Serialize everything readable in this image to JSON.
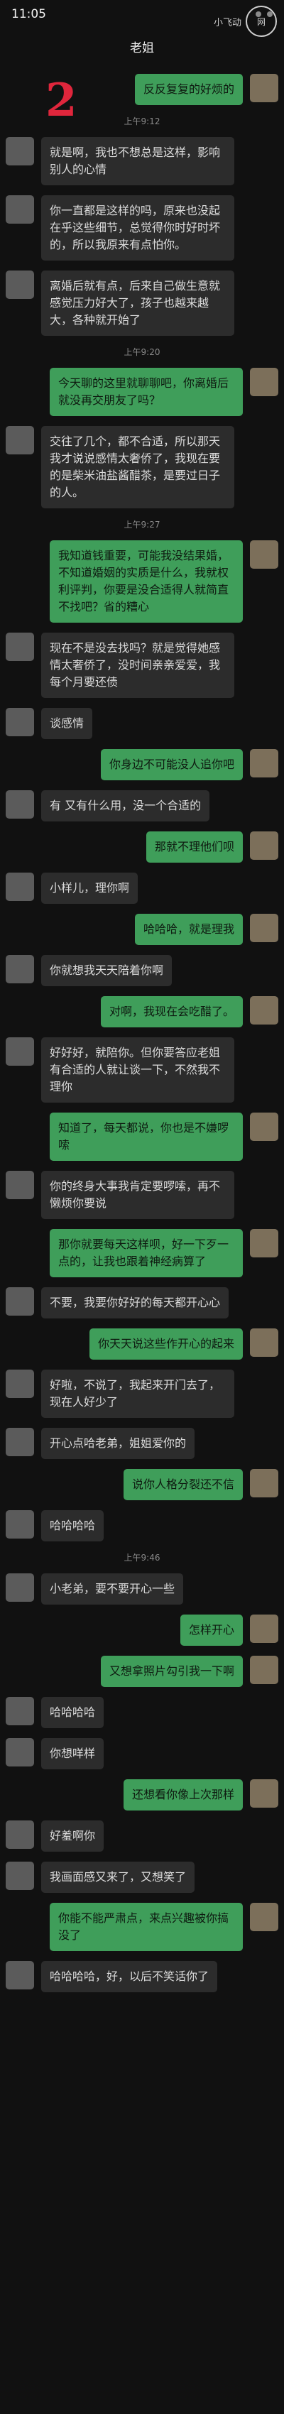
{
  "status": {
    "clock": "11:05",
    "indicators": "• • •"
  },
  "watermark": {
    "text": "小飞动",
    "badge": "网"
  },
  "nav": {
    "title": "老姐"
  },
  "handwritten": "2",
  "messages": [
    {
      "side": "right",
      "text": "反反复复的好烦的"
    },
    {
      "type": "time",
      "text": "上午9:12"
    },
    {
      "side": "left",
      "text": "就是啊，我也不想总是这样，影响别人的心情"
    },
    {
      "side": "left",
      "text": "你一直都是这样的吗，原来也没起在乎这些细节，总觉得你时好时坏的，所以我原来有点怕你。"
    },
    {
      "side": "left",
      "text": "离婚后就有点，后来自己做生意就感觉压力好大了，孩子也越来越大，各种就开始了"
    },
    {
      "type": "time",
      "text": "上午9:20"
    },
    {
      "side": "right",
      "text": "今天聊的这里就聊聊吧，你离婚后就没再交朋友了吗？"
    },
    {
      "side": "left",
      "text": "交往了几个，都不合适，所以那天我才说说感情太奢侨了，我现在要的是柴米油盐酱醋茶，是要过日子的人。"
    },
    {
      "type": "time",
      "text": "上午9:27"
    },
    {
      "side": "right",
      "text": "我知道钱重要，可能我没结果婚，不知道婚姻的实质是什么，我就权利评判，你要是没合适得人就简直不找吧？省的糟心"
    },
    {
      "side": "left",
      "text": "现在不是没去找吗？就是觉得她感情太奢侨了，没时间亲亲爱爱，我每个月要还债"
    },
    {
      "side": "left",
      "text": "谈感情"
    },
    {
      "side": "right",
      "text": "你身边不可能没人追你吧"
    },
    {
      "side": "left",
      "text": "有 又有什么用，没一个合适的"
    },
    {
      "side": "right",
      "text": "那就不理他们呗"
    },
    {
      "side": "left",
      "text": "小样儿，理你啊"
    },
    {
      "side": "right",
      "text": "哈哈哈，就是理我"
    },
    {
      "side": "left",
      "text": "你就想我天天陪着你啊"
    },
    {
      "side": "right",
      "text": "对啊，我现在会吃醋了。"
    },
    {
      "side": "left",
      "text": "好好好，就陪你。但你要答应老姐有合适的人就让谈一下，不然我不理你"
    },
    {
      "side": "right",
      "text": "知道了，每天都说，你也是不嫌啰嗦"
    },
    {
      "side": "left",
      "text": "你的终身大事我肯定要啰嗦，再不懒烦你要说"
    },
    {
      "side": "right",
      "text": "那你就要每天这样呗，好一下歹一点的，让我也跟着神经病算了"
    },
    {
      "side": "left",
      "text": "不要，我要你好好的每天都开心心"
    },
    {
      "side": "right",
      "text": "你天天说这些作开心的起来"
    },
    {
      "side": "left",
      "text": "好啦，不说了，我起来开门去了，现在人好少了"
    },
    {
      "side": "left",
      "text": "开心点哈老弟，姐姐爱你的"
    },
    {
      "side": "right",
      "text": "说你人格分裂还不信"
    },
    {
      "side": "left",
      "text": "哈哈哈哈"
    },
    {
      "type": "time",
      "text": "上午9:46"
    },
    {
      "side": "left",
      "text": "小老弟，要不要开心一些"
    },
    {
      "side": "right",
      "text": "怎样开心"
    },
    {
      "side": "right",
      "text": "又想拿照片勾引我一下啊"
    },
    {
      "side": "left",
      "text": "哈哈哈哈"
    },
    {
      "side": "left",
      "text": "你想咩样"
    },
    {
      "side": "right",
      "text": "还想看你像上次那样"
    },
    {
      "side": "left",
      "text": "好羞啊你"
    },
    {
      "side": "left",
      "text": "我画面感又来了，又想笑了"
    },
    {
      "side": "right",
      "text": "你能不能严肃点，来点兴趣被你搞没了"
    },
    {
      "side": "left",
      "text": "哈哈哈哈，好，以后不笑话你了"
    }
  ]
}
